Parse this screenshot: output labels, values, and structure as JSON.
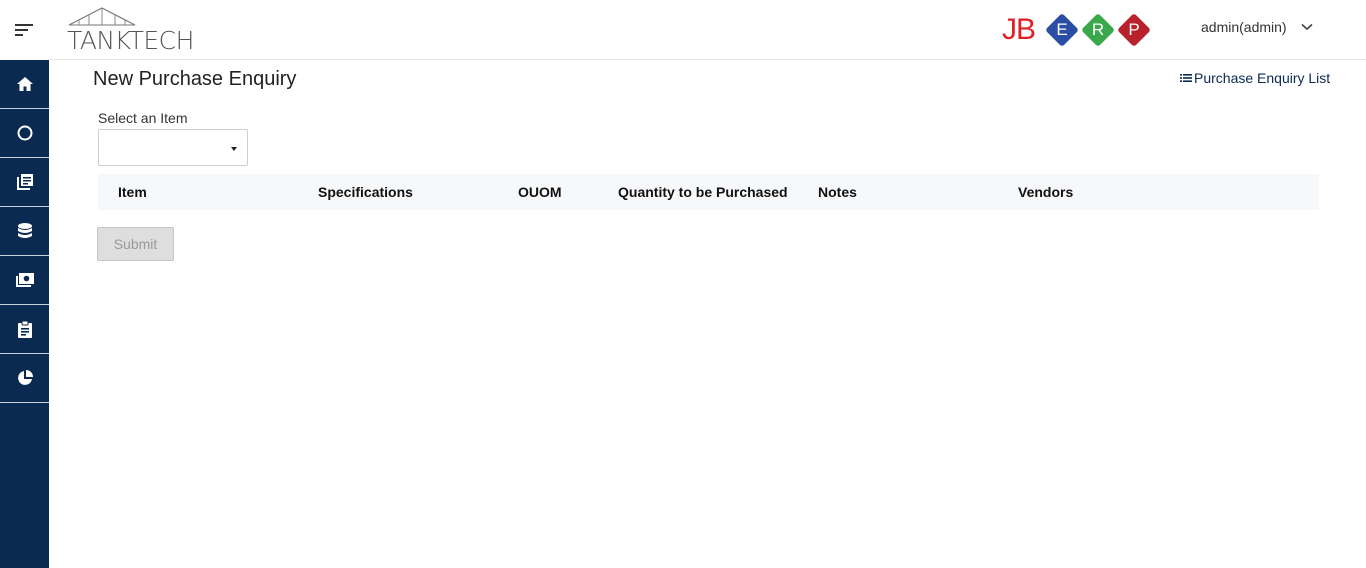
{
  "header": {
    "brand_left": "TANKTECH",
    "brand_right_prefix": "JB",
    "brand_right_letters": [
      "E",
      "R",
      "P"
    ],
    "user_label": "admin(admin)"
  },
  "sidebar": {
    "items": [
      {
        "icon": "home-icon"
      },
      {
        "icon": "circle-icon"
      },
      {
        "icon": "library-icon"
      },
      {
        "icon": "database-icon"
      },
      {
        "icon": "money-icon"
      },
      {
        "icon": "clipboard-icon"
      },
      {
        "icon": "pie-chart-icon"
      }
    ]
  },
  "main": {
    "title": "New Purchase Enquiry",
    "list_link": "Purchase Enquiry List",
    "select_label": "Select an Item",
    "select_value": "",
    "columns": [
      "Item",
      "Specifications",
      "OUOM",
      "Quantity to be Purchased",
      "Notes",
      "Vendors"
    ],
    "submit_label": "Submit"
  },
  "colors": {
    "sidebar": "#0b2a52",
    "jb_red": "#e01f26",
    "erp_blue": "#2a4ea3",
    "erp_green": "#3aa84a",
    "erp_red": "#b8222a"
  }
}
